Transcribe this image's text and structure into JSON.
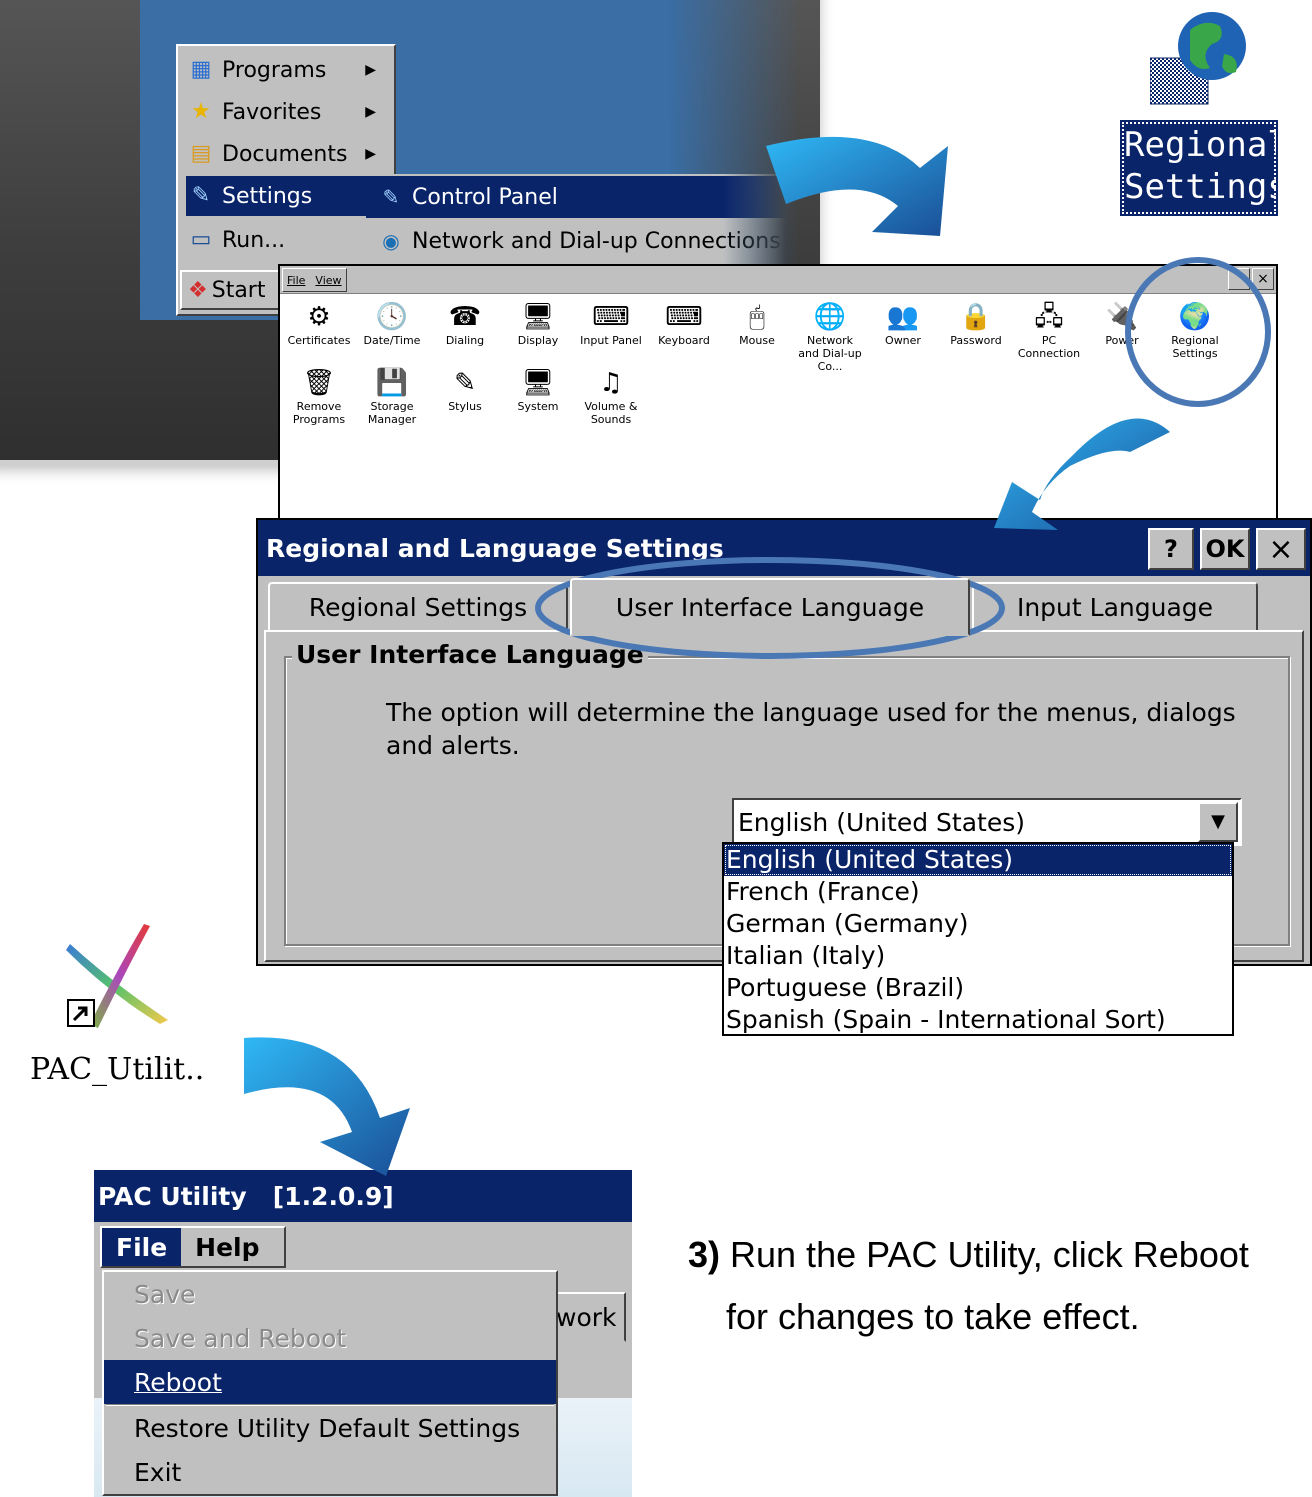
{
  "start_menu": {
    "items": [
      {
        "label": "Programs",
        "icon": "programs-icon"
      },
      {
        "label": "Favorites",
        "icon": "favorites-star-icon"
      },
      {
        "label": "Documents",
        "icon": "documents-icon"
      },
      {
        "label": "Settings",
        "icon": "settings-icon"
      },
      {
        "label": "Run...",
        "icon": "run-icon"
      }
    ],
    "start_label": "Start",
    "submenu": [
      {
        "label": "Control Panel",
        "icon": "control-panel-icon"
      },
      {
        "label": "Network and Dial-up Connections",
        "icon": "network-icon"
      }
    ]
  },
  "regional_icon": {
    "label_line1": "Regional",
    "label_line2": "Settings"
  },
  "control_panel": {
    "menu": [
      "File",
      "View"
    ],
    "close": "×",
    "items_row1": [
      {
        "label": "Certificates",
        "glyph": "⚙"
      },
      {
        "label": "Date/Time",
        "glyph": "🕓"
      },
      {
        "label": "Dialing",
        "glyph": "☎"
      },
      {
        "label": "Display",
        "glyph": "🖥"
      },
      {
        "label": "Input Panel",
        "glyph": "⌨"
      },
      {
        "label": "Keyboard",
        "glyph": "⌨"
      },
      {
        "label": "Mouse",
        "glyph": "🖱"
      },
      {
        "label": "Network and Dial-up Co...",
        "glyph": "🌐"
      },
      {
        "label": "Owner",
        "glyph": "👥"
      },
      {
        "label": "Password",
        "glyph": "🔒"
      },
      {
        "label": "PC Connection",
        "glyph": "🖧"
      },
      {
        "label": "Power",
        "glyph": "🔌"
      },
      {
        "label": "Regional Settings",
        "glyph": "🌍"
      }
    ],
    "items_row2": [
      {
        "label": "Remove Programs",
        "glyph": "🗑"
      },
      {
        "label": "Storage Manager",
        "glyph": "💾"
      },
      {
        "label": "Stylus",
        "glyph": "✎"
      },
      {
        "label": "System",
        "glyph": "🖥"
      },
      {
        "label": "Volume & Sounds",
        "glyph": "♫"
      }
    ]
  },
  "regional_dialog": {
    "title": "Regional and Language Settings",
    "help_button": "?",
    "ok_button": "OK",
    "close_button": "×",
    "tabs": [
      "Regional Settings",
      "User Interface Language",
      "Input Language"
    ],
    "active_tab": 1,
    "group_title": "User Interface Language",
    "description": "The option will determine the language used for the menus, dialogs and alerts.",
    "selected_language": "English (United States)",
    "language_options": [
      "English (United States)",
      "French (France)",
      "German (Germany)",
      "Italian (Italy)",
      "Portuguese (Brazil)",
      "Spanish (Spain - International Sort)"
    ]
  },
  "pac_shortcut": {
    "label": "PAC_Utilit.."
  },
  "pac_window": {
    "title": "PAC Utility   [1.2.0.9]",
    "menu_file": "File",
    "menu_help": "Help",
    "visible_tab": "work",
    "file_menu": [
      {
        "label": "Save",
        "state": "disabled"
      },
      {
        "label": "Save and Reboot",
        "state": "disabled"
      },
      {
        "label": "Reboot",
        "state": "highlighted"
      },
      {
        "label": "Restore Utility Default Settings",
        "state": "normal"
      },
      {
        "label": "Exit",
        "state": "normal"
      }
    ]
  },
  "instruction": {
    "step": "3)",
    "line1": " Run the PAC Utility, click Reboot",
    "line2": "for changes to take effect."
  },
  "colors": {
    "titlebar": "#0a246a",
    "face": "#c0c0c0",
    "arrow_light": "#29b6f6",
    "arrow_dark": "#1a4e96",
    "highlight_ring": "#4a78b5"
  }
}
